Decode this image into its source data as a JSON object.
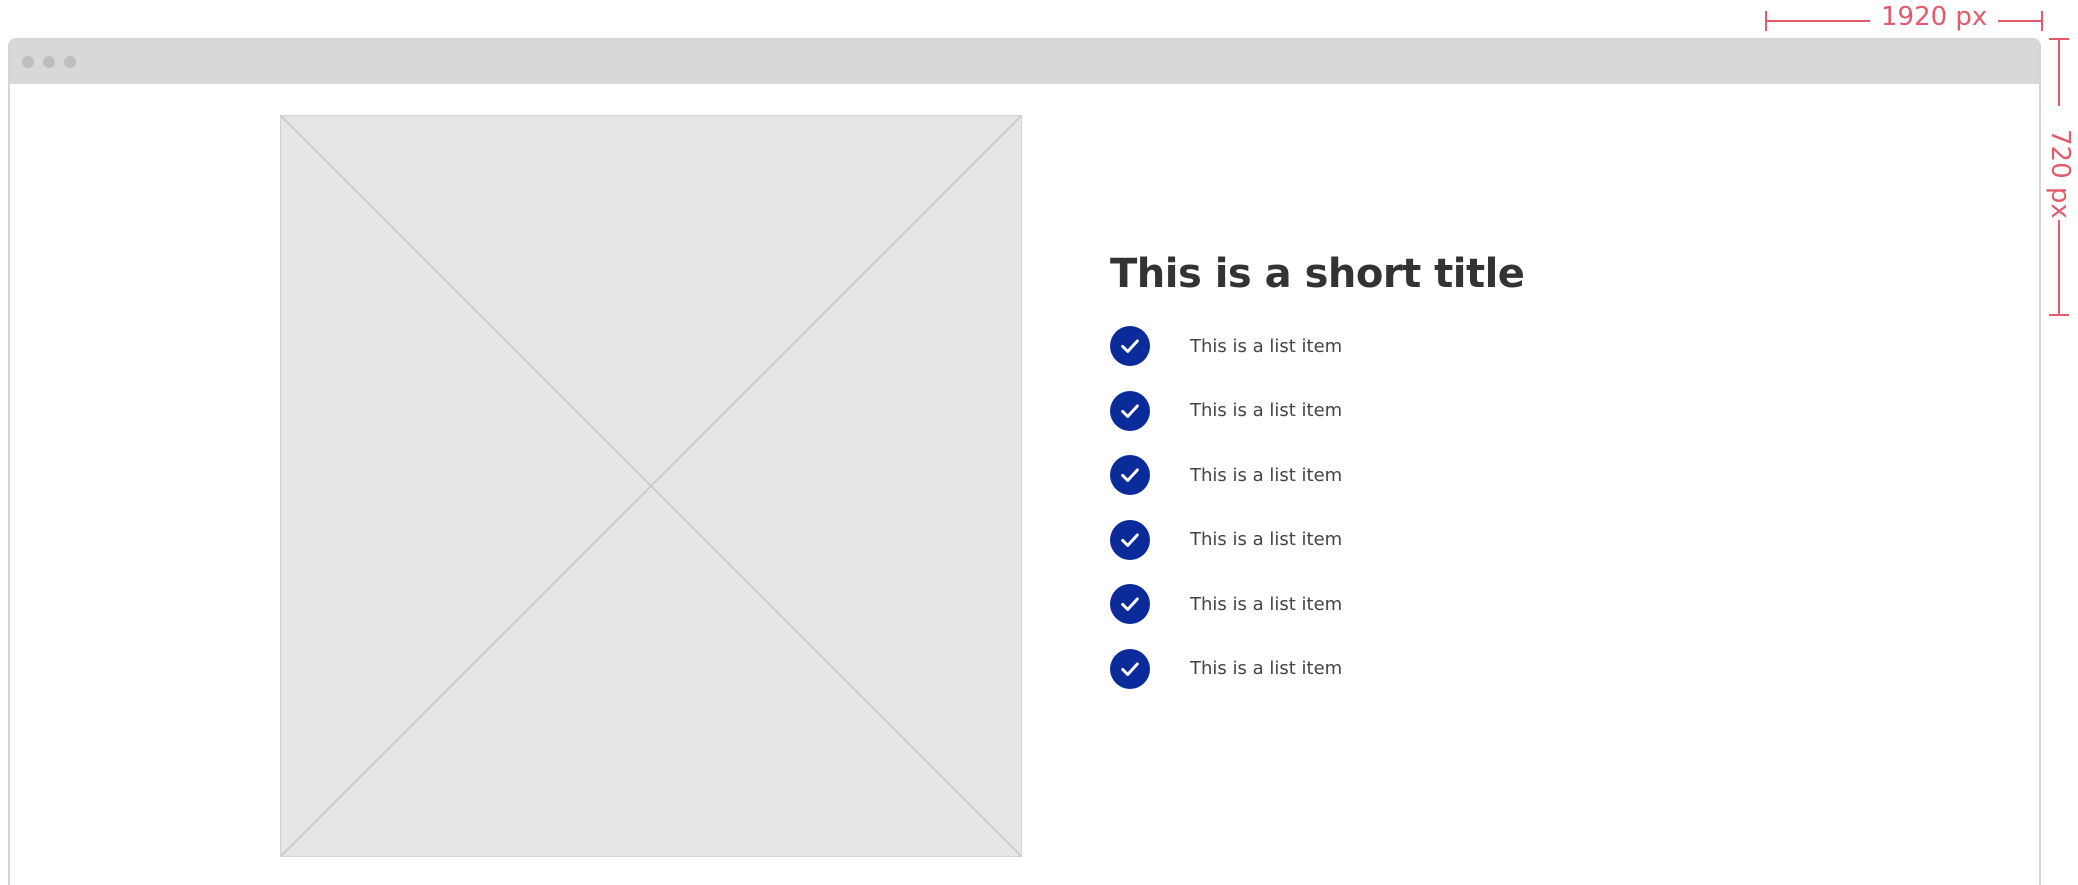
{
  "annotations": {
    "width_label": "1920 px",
    "height_label": "720 px"
  },
  "browser": {
    "window_controls": [
      "dot",
      "dot",
      "dot"
    ]
  },
  "main": {
    "image_placeholder": "image-placeholder",
    "title": "This is a short title",
    "items": [
      {
        "label": "This is a list item",
        "icon": "check-circle-icon"
      },
      {
        "label": "This is a list item",
        "icon": "check-circle-icon"
      },
      {
        "label": "This is a list item",
        "icon": "check-circle-icon"
      },
      {
        "label": "This is a list item",
        "icon": "check-circle-icon"
      },
      {
        "label": "This is a list item",
        "icon": "check-circle-icon"
      },
      {
        "label": "This is a list item",
        "icon": "check-circle-icon"
      }
    ]
  },
  "colors": {
    "accent": "#0b2b9a",
    "annotation": "#e25b6b",
    "placeholder": "#e6e6e6",
    "title": "#333333"
  }
}
